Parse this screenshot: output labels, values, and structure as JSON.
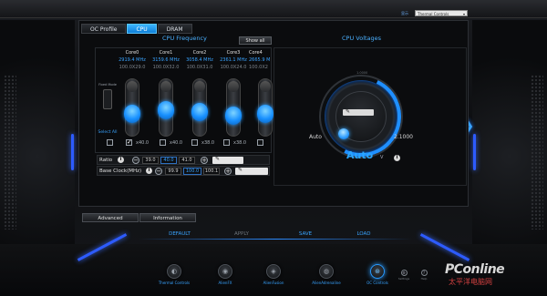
{
  "header": {
    "language_label": "显示",
    "language_value": "Thermal Controls"
  },
  "tabs": [
    {
      "label": "OC Profile",
      "active": false
    },
    {
      "label": "CPU",
      "active": true
    },
    {
      "label": "DRAM",
      "active": false
    }
  ],
  "cpu_frequency": {
    "title": "CPU Frequency",
    "show_all_label": "Show all",
    "mode_label_top": "Fixed Mode",
    "select_all_label": "Select All",
    "cores": [
      {
        "name": "Core0",
        "freq": "2919.4 MHz",
        "mult": "100.0X29.0",
        "checked": true,
        "offset": "x40.0"
      },
      {
        "name": "Core1",
        "freq": "3159.6 MHz",
        "mult": "100.0X32.0",
        "checked": false,
        "offset": "x40.0"
      },
      {
        "name": "Core2",
        "freq": "3058.4 MHz",
        "mult": "100.0X31.0",
        "checked": false,
        "offset": "x38.0"
      },
      {
        "name": "Core3",
        "freq": "2361.1 MHz",
        "mult": "100.0X24.0",
        "checked": false,
        "offset": "x38.0"
      },
      {
        "name": "Core4",
        "freq": "2665.9 M",
        "mult": "100.0X2",
        "checked": false,
        "offset": "x38.0"
      }
    ],
    "ratio": {
      "label": "Ratio",
      "min": "39.0",
      "value": "40.0",
      "max": "41.0"
    },
    "bclk": {
      "label": "Base Clock(MHz)",
      "min": "99.9",
      "value": "100.0",
      "max": "100.1"
    }
  },
  "cpu_voltages": {
    "title": "CPU Voltages",
    "top_label": "1.0000",
    "min_label": "Auto",
    "max_label": "2.1000",
    "value": "Auto",
    "unit": "V"
  },
  "bottom_tabs": [
    {
      "label": "Advanced"
    },
    {
      "label": "Information"
    }
  ],
  "actions": [
    {
      "label": "DEFAULT",
      "disabled": false
    },
    {
      "label": "APPLY",
      "disabled": true
    },
    {
      "label": "SAVE",
      "disabled": false
    },
    {
      "label": "LOAD",
      "disabled": false
    }
  ],
  "dock": [
    {
      "label": "Thermal Controls",
      "icon": "thermal-icon",
      "active": false
    },
    {
      "label": "AlienFX",
      "icon": "alienfx-icon",
      "active": false
    },
    {
      "label": "AlienFusion",
      "icon": "alienfusion-icon",
      "active": false
    },
    {
      "label": "AlienAdrenaline",
      "icon": "adrenaline-icon",
      "active": false
    },
    {
      "label": "OC Controls",
      "icon": "oc-controls-icon",
      "active": true
    }
  ],
  "tools": [
    {
      "label": "Settings"
    },
    {
      "label": "Help"
    }
  ],
  "watermark": {
    "brand": "PConline",
    "sub": "太平洋电脑网"
  },
  "colors": {
    "accent": "#2aa6ff",
    "glow": "#2d5bff"
  }
}
